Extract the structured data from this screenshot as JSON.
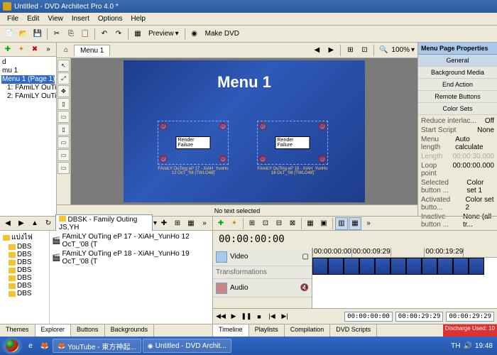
{
  "window_title": "Untitled - DVD Architect Pro 4.0 *",
  "menus": {
    "file": "File",
    "edit": "Edit",
    "view": "View",
    "insert": "Insert",
    "options": "Options",
    "help": "Help"
  },
  "maintb": {
    "preview": "Preview",
    "makedvd": "Make DVD"
  },
  "tree": {
    "root": "d",
    "m1": "mu 1",
    "page": "Menu 1 (Page 1)",
    "item1": "1: FAmiLY OuTing eP 1",
    "item2": "2: FAmiLY OuTing eP 1"
  },
  "work": {
    "tab": "Menu 1",
    "zoom": "100%"
  },
  "canvas": {
    "title": "Menu 1",
    "render_failure": "Render Failure",
    "cap1": "FAmiLY OuTing eP 17 - XiAH_YunHo 12 OcT_'08 (TWLO48)",
    "cap2": "FAmiLY OuTing eP 18 - XiAH_YunHo 18 OcT_'08 (TWLO48)"
  },
  "status": "No text selected",
  "props": {
    "header": "Menu Page Properties",
    "sections": {
      "general": "General",
      "bgmedia": "Background Media",
      "endaction": "End Action",
      "remote": "Remote Buttons",
      "colorsets": "Color Sets"
    },
    "rows": [
      {
        "k": "Reduce interlac...",
        "v": "Off"
      },
      {
        "k": "Start Script",
        "v": "None"
      },
      {
        "k": "Menu length",
        "v": "Auto calculate"
      },
      {
        "k": "Length",
        "v": "00:00:30.000"
      },
      {
        "k": "Loop point",
        "v": "00:00:00.000"
      },
      {
        "k": "Selected button ...",
        "v": "Color set 1"
      },
      {
        "k": "Activated butto...",
        "v": "Color set 2"
      },
      {
        "k": "Inactive button ...",
        "v": "None (all tr..."
      }
    ]
  },
  "explorer": {
    "path": "DBSK - Family Outing JS,YH",
    "treelabel": "แบ่งไฟ",
    "folder": "DBS",
    "files": [
      "FAmiLY OuTing eP 17 - XiAH_YunHo 12 OcT_'08 (T",
      "FAmiLY OuTing eP 18 - XiAH_YunHo 19 OcT_'08 (T"
    ],
    "tabs": {
      "themes": "Themes",
      "explorer": "Explorer",
      "buttons": "Buttons",
      "backgrounds": "Backgrounds"
    }
  },
  "timeline": {
    "timecode": "00:00:00:00",
    "tracks": {
      "video": "Video",
      "transform": "Transformations",
      "audio": "Audio"
    },
    "ruler": [
      "00:00:00:00",
      "00:00:09:29",
      "",
      "00:00:19:29",
      ""
    ],
    "transport": {
      "t1": "00:00:00:00",
      "t2": "00:00:29:29",
      "t3": "00:00:29:29"
    },
    "tabs": {
      "timeline": "Timeline",
      "playlists": "Playlists",
      "compilation": "Compilation",
      "scripts": "DVD Scripts"
    }
  },
  "taskbar": {
    "items": [
      "YouTube - 東方神起...",
      "Untitled - DVD Archit..."
    ],
    "lang": "TH",
    "discharge": "Discharge Used: 10",
    "clock": "19:48"
  },
  "icons": {
    "dd": "▾",
    "play": "▶",
    "pause": "❚❚",
    "stop": "■",
    "prev": "|◀",
    "next": "▶|",
    "first": "◀◀",
    "last": "▶▶"
  }
}
